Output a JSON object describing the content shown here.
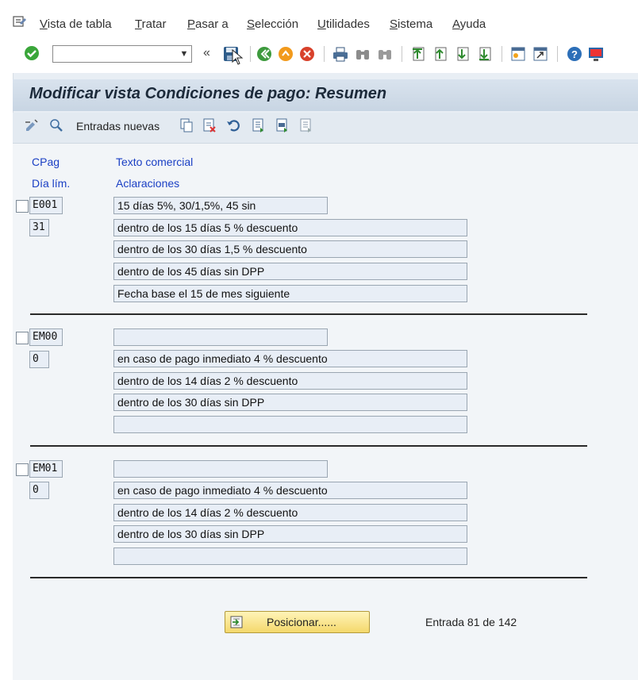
{
  "menubar": {
    "items": [
      "Vista de tabla",
      "Tratar",
      "Pasar a",
      "Selección",
      "Utilidades",
      "Sistema",
      "Ayuda"
    ],
    "underline": [
      "V",
      "T",
      "P",
      "S",
      "U",
      "S",
      "A"
    ],
    "rest": [
      "ista de tabla",
      "ratar",
      "asar a",
      "elección",
      "tilidades",
      "istema",
      "yuda"
    ]
  },
  "toolbar": {
    "command_value": "",
    "chevron": "«",
    "icons": [
      "menu-icon",
      "enter-check-icon",
      "save-icon",
      "back-icon",
      "exit-icon",
      "cancel-icon",
      "print-icon",
      "find-icon",
      "find-next-icon",
      "first-page-icon",
      "previous-page-icon",
      "next-page-icon",
      "last-page-icon",
      "new-session-icon",
      "shortcut-icon",
      "help-icon",
      "customize-layout-icon"
    ]
  },
  "title": "Modificar vista Condiciones de pago: Resumen",
  "app_toolbar": {
    "new_entries": "Entradas nuevas",
    "icons": [
      "display-change-icon",
      "details-icon",
      "copy-as-icon",
      "delete-icon",
      "undo-change-icon",
      "select-all-icon",
      "select-block-icon",
      "deselect-all-icon"
    ]
  },
  "headers": {
    "cpag": "CPag",
    "texto": "Texto comercial",
    "dia": "Día lím.",
    "aclaraciones": "Aclaraciones"
  },
  "blocks": [
    {
      "code": "E001",
      "day": "31",
      "text": "15 días 5%, 30/1,5%, 45 sin",
      "lines": [
        "dentro de los 15 días 5 % descuento",
        "dentro de los 30 días 1,5 % descuento",
        "dentro de los 45 días sin DPP",
        "Fecha base el 15 de mes siguiente"
      ]
    },
    {
      "code": "EM00",
      "day": "0",
      "text": "",
      "lines": [
        "en caso de pago inmediato 4 % descuento",
        "dentro de los 14 días 2 % descuento",
        "dentro de los 30 días sin DPP",
        ""
      ]
    },
    {
      "code": "EM01",
      "day": "0",
      "text": "",
      "lines": [
        "en caso de pago inmediato 4 % descuento",
        "dentro de los 14 días 2 % descuento",
        "dentro de los 30 días sin DPP",
        ""
      ]
    }
  ],
  "position_button": "Posicionar......",
  "entry_count": "Entrada 81 de 142"
}
